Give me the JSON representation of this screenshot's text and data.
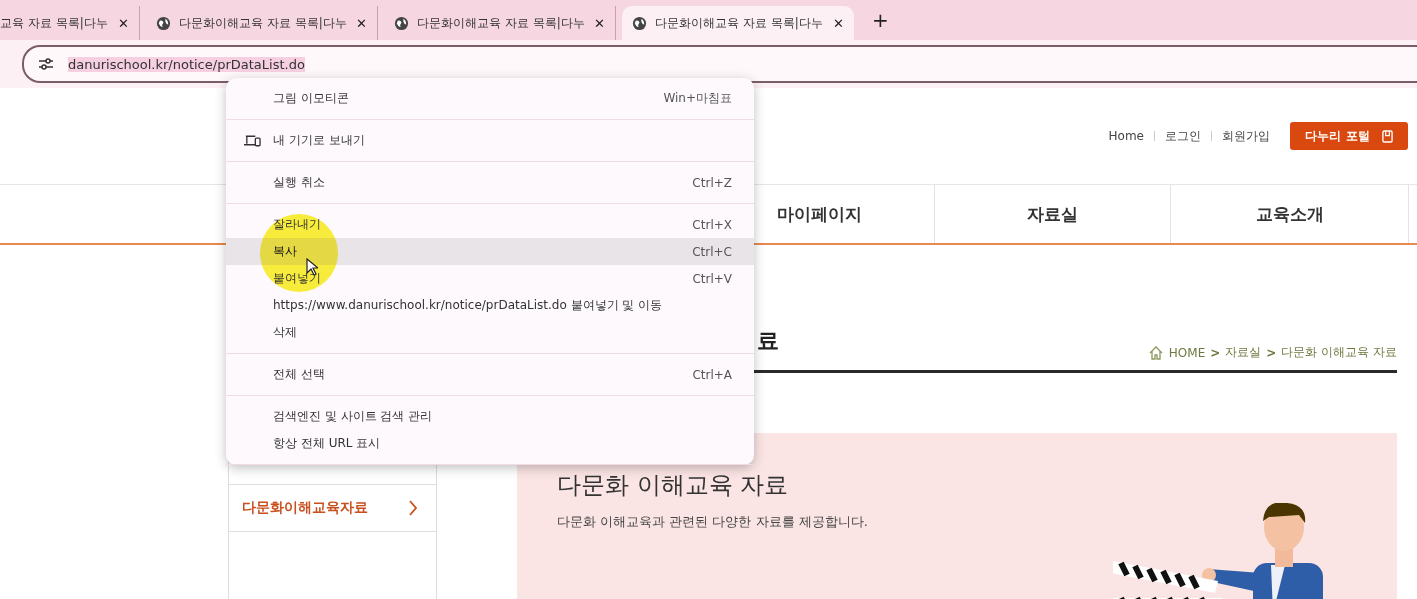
{
  "browser": {
    "tabs": [
      {
        "title": "교육 자료 목록|다누",
        "close": "✕",
        "selected": false,
        "cut": true
      },
      {
        "title": "다문화이해교육 자료 목록|다누",
        "close": "✕",
        "selected": false,
        "cut": false
      },
      {
        "title": "다문화이해교육 자료 목록|다누",
        "close": "✕",
        "selected": false,
        "cut": false
      },
      {
        "title": "다문화이해교육 자료 목록|다누",
        "close": "✕",
        "selected": true,
        "cut": false
      }
    ],
    "new_tab": "+",
    "address": {
      "url": "danurischool.kr/notice/prDataList.do"
    }
  },
  "header": {
    "links": [
      "Home",
      "로그인",
      "회원가입"
    ],
    "portal_button": "다누리 포털"
  },
  "nav": [
    {
      "label": "마이페이지"
    },
    {
      "label": "자료실"
    },
    {
      "label": "교육소개"
    }
  ],
  "sidebar": {
    "items": [
      {
        "label": "다문화이해교육자료",
        "selected": true
      }
    ]
  },
  "page": {
    "heading": "료",
    "breadcrumb": [
      "HOME",
      "자료실",
      "다문화 이해교육 자료"
    ],
    "separator": ">"
  },
  "banner": {
    "title": "다문화 이해교육 자료",
    "subtitle": "다문화 이해교육과 관련된 다양한 자료를 제공합니다."
  },
  "context_menu": {
    "sections": [
      [
        {
          "kind": "plain",
          "label": "그림 이모티콘",
          "shortcut": "Win+마침표",
          "selected": false
        }
      ],
      [
        {
          "kind": "icon",
          "label": "내 기기로 보내기",
          "selected": false
        }
      ],
      [
        {
          "kind": "plain",
          "label": "실행 취소",
          "shortcut": "Ctrl+Z",
          "selected": false
        }
      ],
      [
        {
          "kind": "plain",
          "label": "잘라내기",
          "shortcut": "Ctrl+X",
          "selected": false
        },
        {
          "kind": "plain",
          "label": "복사",
          "shortcut": "Ctrl+C",
          "selected": true
        },
        {
          "kind": "plain",
          "label": "붙여넣기",
          "shortcut": "Ctrl+V",
          "selected": false
        },
        {
          "kind": "plain",
          "label": "https://www.danurischool.kr/notice/prDataList.do 붙여넣기 및 이동",
          "selected": false
        },
        {
          "kind": "plain",
          "label": "삭제",
          "selected": false
        }
      ],
      [
        {
          "kind": "plain",
          "label": "전체 선택",
          "shortcut": "Ctrl+A",
          "selected": false
        }
      ],
      [
        {
          "kind": "plain",
          "label": "검색엔진 및 사이트 검색 관리",
          "selected": false
        },
        {
          "kind": "plain",
          "label": "항상 전체 URL 표시",
          "selected": false
        }
      ]
    ]
  }
}
